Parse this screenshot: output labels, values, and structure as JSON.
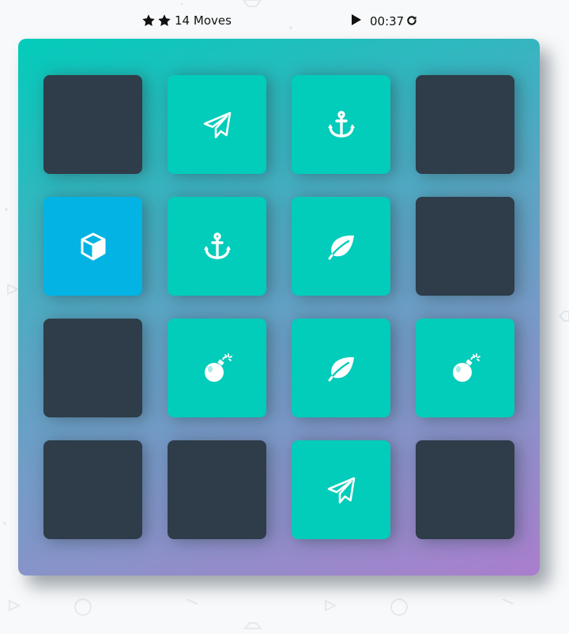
{
  "score_panel": {
    "stars": [
      {
        "icon": "star-icon"
      },
      {
        "icon": "star-icon"
      }
    ],
    "moves_count": "14",
    "moves_label": "Moves",
    "timer_icon": "play-icon",
    "timer": "00:37",
    "restart_icon": "restart-icon"
  },
  "deck": {
    "cards": [
      {
        "state": "closed",
        "icon": ""
      },
      {
        "state": "match",
        "icon": "paper-plane-icon"
      },
      {
        "state": "match",
        "icon": "anchor-icon"
      },
      {
        "state": "closed",
        "icon": ""
      },
      {
        "state": "open",
        "icon": "cube-icon"
      },
      {
        "state": "match",
        "icon": "anchor-icon"
      },
      {
        "state": "match",
        "icon": "leaf-icon"
      },
      {
        "state": "closed",
        "icon": ""
      },
      {
        "state": "closed",
        "icon": ""
      },
      {
        "state": "match",
        "icon": "bomb-icon"
      },
      {
        "state": "match",
        "icon": "leaf-icon"
      },
      {
        "state": "match",
        "icon": "bomb-icon"
      },
      {
        "state": "closed",
        "icon": ""
      },
      {
        "state": "closed",
        "icon": ""
      },
      {
        "state": "match",
        "icon": "paper-plane-icon"
      },
      {
        "state": "closed",
        "icon": ""
      }
    ]
  },
  "colors": {
    "card_closed": "#2e3d49",
    "card_match": "#02ccba",
    "card_open": "#02b3e4",
    "deck_gradient_start": "#02ccba",
    "deck_gradient_end": "#aa7ecd",
    "page_background": "#f8f9fa"
  }
}
